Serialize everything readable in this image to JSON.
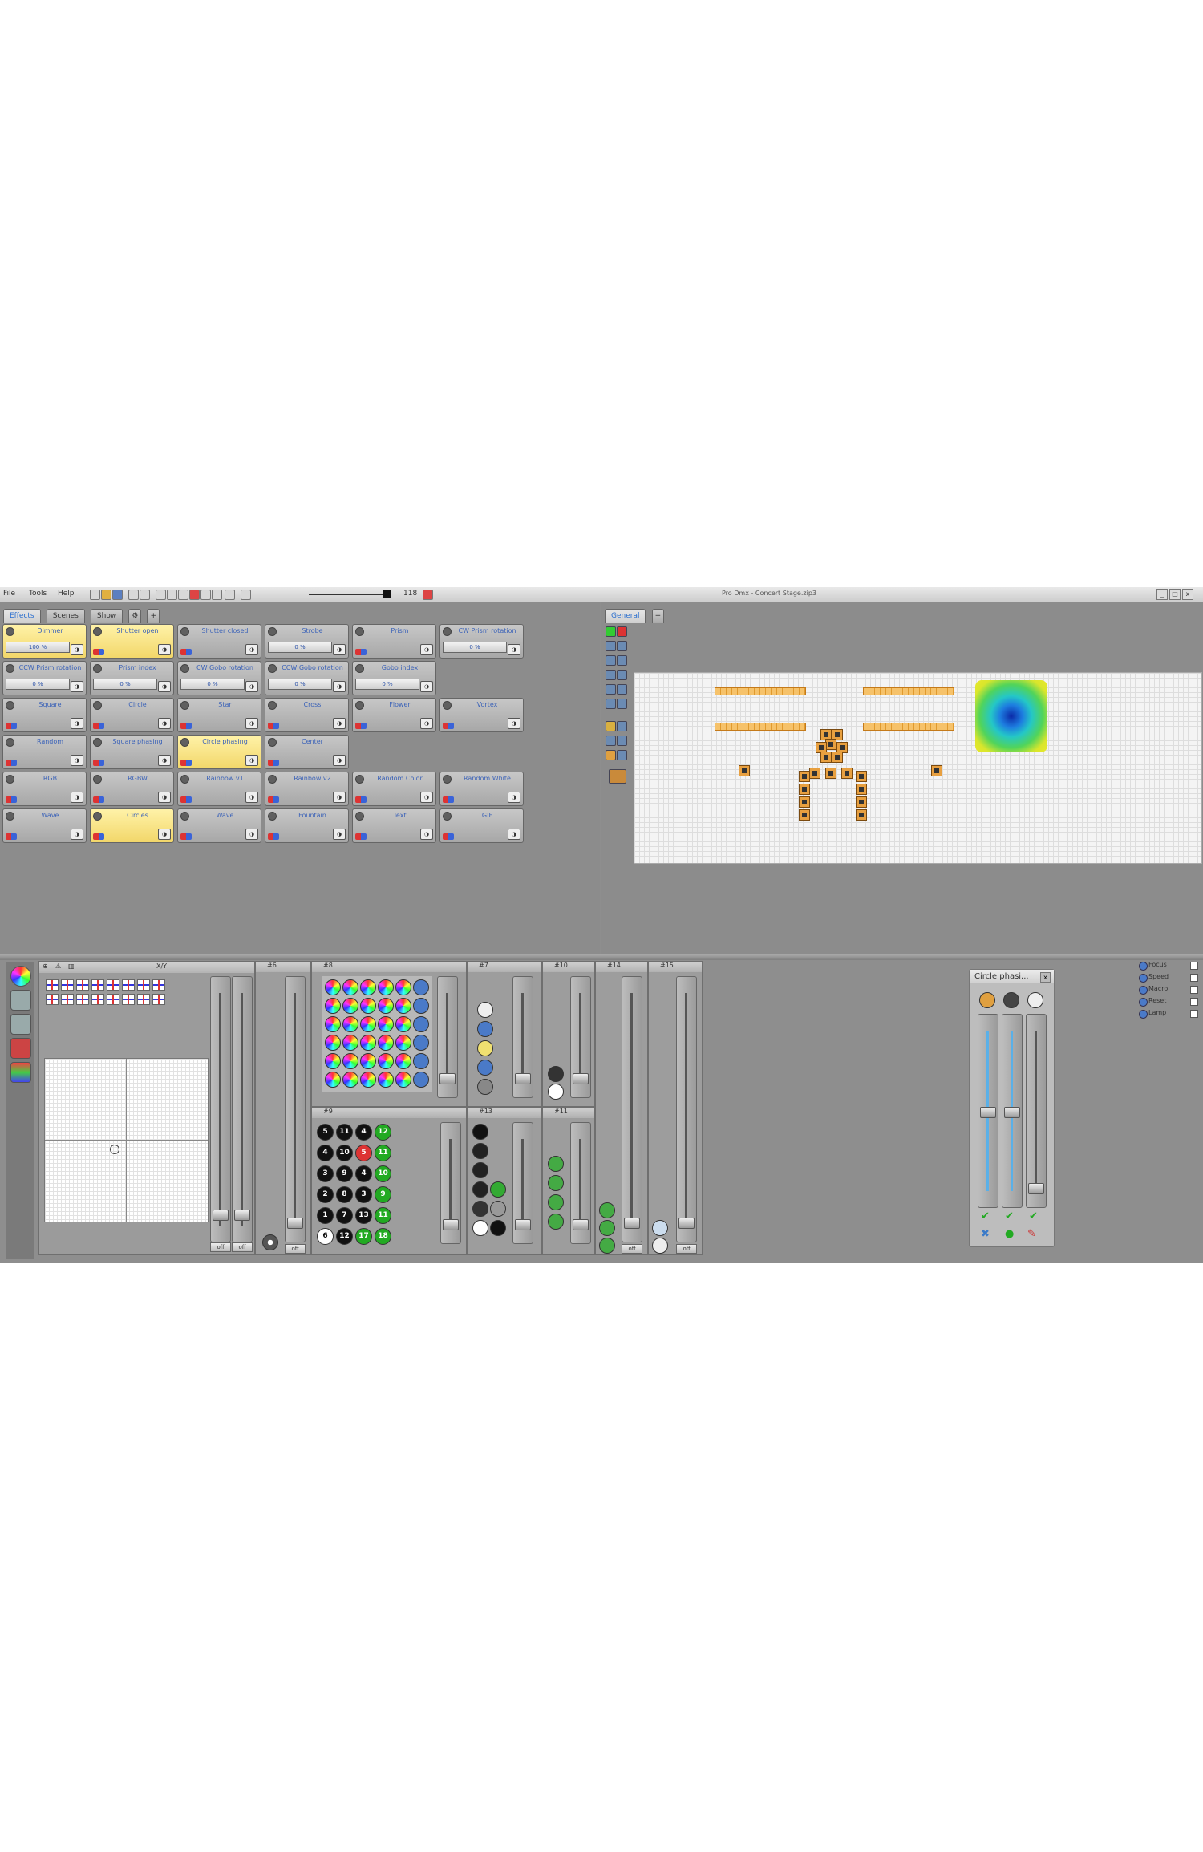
{
  "menu": {
    "file": "File",
    "tools": "Tools",
    "help": "Help",
    "zoom_value": "118"
  },
  "window_title": "Pro Dmx - Concert Stage.zip3",
  "left_tabs": [
    "Effects",
    "Scenes",
    "Show"
  ],
  "right_tabs": [
    "General"
  ],
  "effects": [
    {
      "label": "Dimmer",
      "value": "100 %",
      "highlight": true
    },
    {
      "label": "Shutter open",
      "highlight": true
    },
    {
      "label": "Shutter closed"
    },
    {
      "label": "Strobe",
      "value": "0 %"
    },
    {
      "label": "Prism"
    },
    {
      "label": "CW Prism rotation",
      "value": "0 %"
    },
    {
      "label": "CCW Prism rotation",
      "value": "0 %"
    },
    {
      "label": "Prism index",
      "value": "0 %"
    },
    {
      "label": "CW Gobo rotation",
      "value": "0 %"
    },
    {
      "label": "CCW Gobo rotation",
      "value": "0 %"
    },
    {
      "label": "Gobo index",
      "value": "0 %"
    },
    {
      "label": "Square"
    },
    {
      "label": "Circle"
    },
    {
      "label": "Star"
    },
    {
      "label": "Cross"
    },
    {
      "label": "Flower"
    },
    {
      "label": "Vortex"
    },
    {
      "label": "Random"
    },
    {
      "label": "Square phasing"
    },
    {
      "label": "Circle phasing",
      "highlight": true
    },
    {
      "label": "Center"
    },
    {
      "label": "RGB"
    },
    {
      "label": "RGBW"
    },
    {
      "label": "Rainbow v1"
    },
    {
      "label": "Rainbow v2"
    },
    {
      "label": "Random Color"
    },
    {
      "label": "Random White"
    },
    {
      "label": "Wave"
    },
    {
      "label": "Circles",
      "highlight": true
    },
    {
      "label": "Wave"
    },
    {
      "label": "Fountain"
    },
    {
      "label": "Text"
    },
    {
      "label": "GIF"
    }
  ],
  "xy_panel": {
    "title": "X/Y"
  },
  "modules": [
    {
      "id": "#6"
    },
    {
      "id": "#8"
    },
    {
      "id": "#7"
    },
    {
      "id": "#10"
    },
    {
      "id": "#14"
    },
    {
      "id": "#15"
    },
    {
      "id": "#9"
    },
    {
      "id": "#13"
    },
    {
      "id": "#11"
    }
  ],
  "off_label": "off",
  "gobo_numbers": [
    "5",
    "11",
    "4",
    "12",
    "4",
    "10",
    "5",
    "11",
    "3",
    "9",
    "4",
    "10",
    "2",
    "8",
    "3",
    "9",
    "1",
    "7",
    "13",
    "11",
    "6",
    "12",
    "17",
    "18"
  ],
  "popup": {
    "title": "Circle phasi...",
    "close": "x"
  },
  "side_list": [
    "Focus",
    "Speed",
    "Macro",
    "Reset",
    "Lamp"
  ],
  "colors": {
    "app_bg": "#8e8e8e",
    "highlight": "#f2d76a",
    "label_blue": "#3c63b8",
    "stage_bg": "#f4f4f4"
  }
}
